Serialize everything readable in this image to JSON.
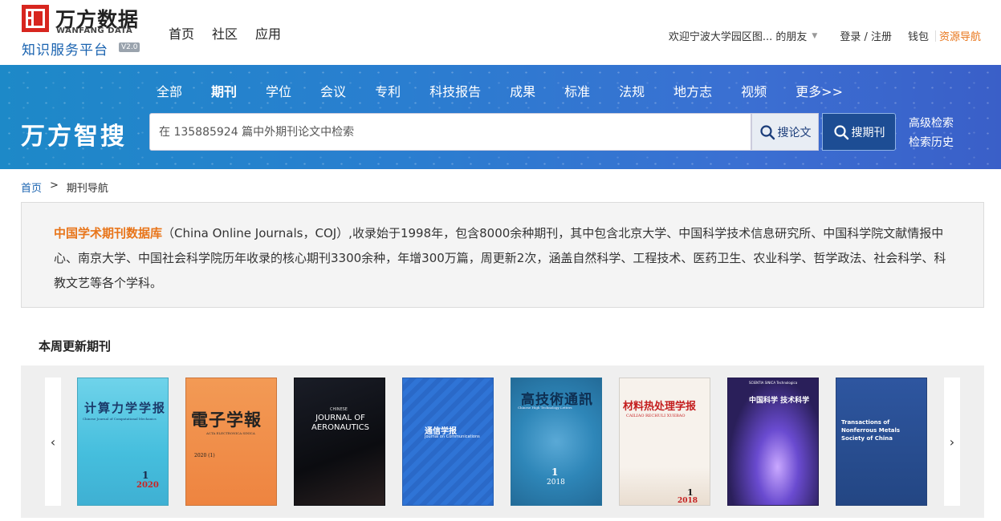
{
  "header": {
    "logo_cn": "万方数据",
    "logo_en": "WANFANG DATA",
    "logo_sub": "知识服务平台",
    "logo_ver": "V2.0",
    "nav": [
      "首页",
      "社区",
      "应用"
    ],
    "welcome": "欢迎宁波大学园区图... 的朋友",
    "login": "登录 / 注册",
    "wallet": "钱包",
    "resource_nav": "资源导航"
  },
  "search": {
    "categories": [
      "全部",
      "期刊",
      "学位",
      "会议",
      "专利",
      "科技报告",
      "成果",
      "标准",
      "法规",
      "地方志",
      "视频",
      "更多>>"
    ],
    "active_category": "期刊",
    "brand": "万方智搜",
    "placeholder": "在 135885924 篇中外期刊论文中检索",
    "btn_paper": "搜论文",
    "btn_journal": "搜期刊",
    "advanced": "高级检索",
    "history": "检索历史"
  },
  "breadcrumb": {
    "home": "首页",
    "sep": ">",
    "current": "期刊导航"
  },
  "intro": {
    "highlight": "中国学术期刊数据库",
    "text": "（China Online Journals，COJ）,收录始于1998年，包含8000余种期刊，其中包含北京大学、中国科学技术信息研究所、中国科学院文献情报中心、南京大学、中国社会科学院历年收录的核心期刊3300余种，年增300万篇，周更新2次，涵盖自然科学、工程技术、医药卫生、农业科学、哲学政法、社会科学、科教文艺等各个学科。"
  },
  "weekly": {
    "title": "本周更新期刊",
    "prev_icon": "‹",
    "next_icon": "›",
    "covers": [
      {
        "title": "计算力学学报",
        "sub": "Chinese Journal of Computational Mechanics",
        "issue": "1",
        "year": "2020",
        "bg": "#4ec3e0"
      },
      {
        "title": "電子学報",
        "sub": "ACTA ELECTRONICA SINICA",
        "issue": "2020 (1)",
        "year": "",
        "bg": "#f08a45"
      },
      {
        "title": "JOURNAL OF AERONAUTICS",
        "sub": "CHINESE",
        "issue": "",
        "year": "",
        "bg": "#111318"
      },
      {
        "title": "通信学报",
        "sub": "Journal on Communications",
        "issue": "",
        "year": "",
        "bg": "#2c6fd0"
      },
      {
        "title": "高技術通訊",
        "sub": "Chinese High Technology Letters",
        "issue": "1",
        "year": "2018",
        "bg": "#2e86b8"
      },
      {
        "title": "材料热处理学报",
        "sub": "CAILIAO RECHULI XUEBAO",
        "issue": "1",
        "year": "2018",
        "bg": "#f7f2ec"
      },
      {
        "title": "中国科学 技术科学",
        "sub": "SCIENTIA SINICA Technologica",
        "issue": "",
        "year": "",
        "bg": "#2a1f5a"
      },
      {
        "title": "Transactions of Nonferrous Metals Society of China",
        "sub": "",
        "issue": "",
        "year": "",
        "bg": "#2a4d8e"
      }
    ]
  }
}
